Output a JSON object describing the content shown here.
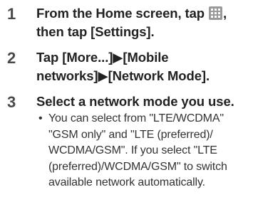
{
  "steps": [
    {
      "number": "1",
      "text_before_icon": "From the Home screen, tap ",
      "icon": "apps-grid-icon",
      "text_after_icon": ", then tap [Settings]."
    },
    {
      "number": "2",
      "text": "Tap [More...]▶[Mobile networks]▶[Network Mode]."
    },
    {
      "number": "3",
      "text": "Select a network mode you use.",
      "bullet": "•",
      "note": "You can select from \"LTE/WCDMA\" \"GSM only\" and \"LTE (preferred)/ WCDMA/GSM\". If you select \"LTE (preferred)/WCDMA/GSM\" to switch available network automatically."
    }
  ]
}
